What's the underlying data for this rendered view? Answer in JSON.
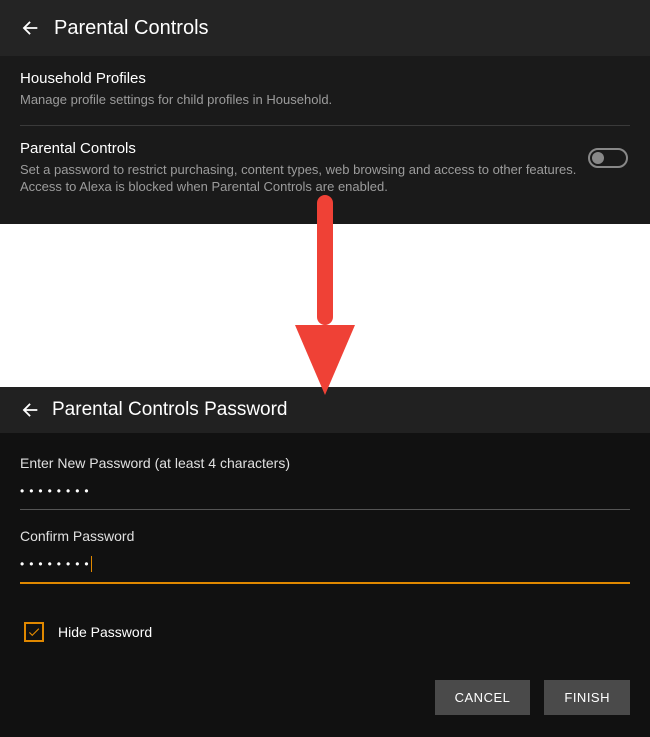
{
  "top": {
    "title": "Parental Controls",
    "household": {
      "heading": "Household Profiles",
      "desc": "Manage profile settings for child profiles in Household."
    },
    "parental": {
      "heading": "Parental Controls",
      "desc": "Set a password to restrict purchasing, content types, web browsing and access to other features. Access to Alexa is blocked when Parental Controls are enabled.",
      "toggle_on": false
    }
  },
  "bottom": {
    "title": "Parental Controls Password",
    "enter_label": "Enter New Password (at least 4 characters)",
    "enter_value": "••••••••",
    "confirm_label": "Confirm Password",
    "confirm_value": "••••••••",
    "hide_label": "Hide Password",
    "hide_checked": true,
    "cancel": "CANCEL",
    "finish": "FINISH"
  }
}
